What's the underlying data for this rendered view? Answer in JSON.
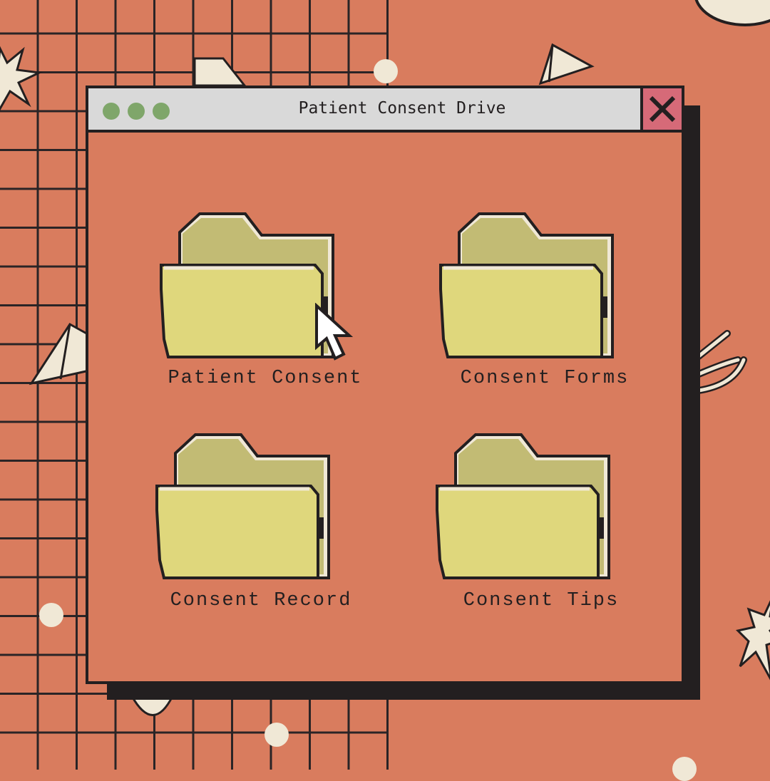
{
  "window": {
    "title": "Patient Consent Drive",
    "close_icon": "close-icon",
    "title_lights": [
      "green-dot",
      "green-dot",
      "green-dot"
    ]
  },
  "folders": [
    {
      "label": "Patient Consent",
      "icon": "folder-icon"
    },
    {
      "label": "Consent Forms",
      "icon": "folder-icon"
    },
    {
      "label": "Consent Record",
      "icon": "folder-icon"
    },
    {
      "label": "Consent Tips",
      "icon": "folder-icon"
    }
  ],
  "colors": {
    "background": "#d97c5e",
    "titlebar": "#d9d9d9",
    "close_button": "#d66a78",
    "traffic_light": "#7fa66a",
    "folder_front": "#dfd77c",
    "folder_back": "#c2bb74",
    "outline": "#231f20",
    "accent_cream": "#f0e8d6"
  }
}
